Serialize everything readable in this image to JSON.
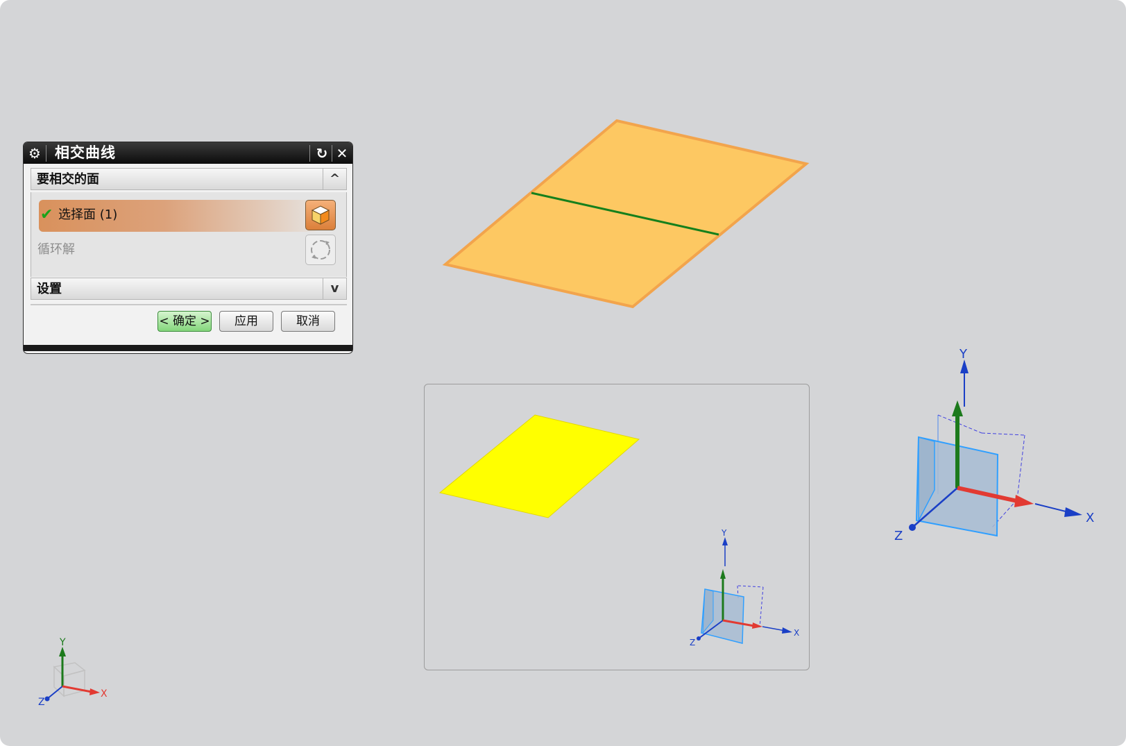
{
  "dialog": {
    "title": "相交曲线",
    "group_faces": "要相交的面",
    "select_label": "选择面 (1)",
    "loop_label": "循环解",
    "group_settings": "设置",
    "ok_label": "< 确定 >",
    "apply_label": "应用",
    "cancel_label": "取消"
  },
  "icons": {
    "title": "gear-icon",
    "reset": "reset-icon",
    "close": "close-icon",
    "collapse": "chevron-up-icon",
    "expand": "chevron-down-icon",
    "select_ok": "check-icon",
    "face_selector": "cube-icon",
    "cycle": "cycle-icon"
  },
  "axes": {
    "x": "X",
    "y": "Y",
    "z": "Z"
  },
  "colors": {
    "background": "#d4d5d7",
    "sheet": "#fdc862",
    "sheet_edge": "#f2a44c",
    "intersection_curve": "#16801c",
    "preview_sheet": "#ffff00",
    "axis_x": "#e23a32",
    "axis_y": "#1c7a1c",
    "axis_blue": "#1a3fc6",
    "plane_fill": "#a7bcd3",
    "plane_edge": "#2f9fff",
    "ok_button": "#84d67b"
  }
}
